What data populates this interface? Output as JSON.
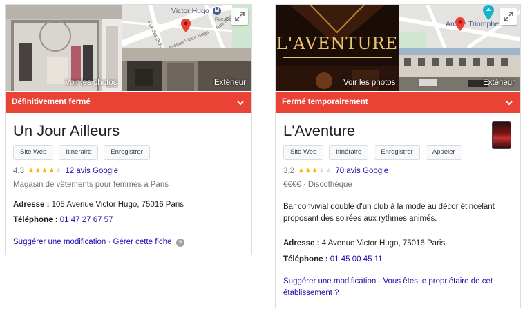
{
  "left": {
    "photo_label": "Voir les photos",
    "street_label": "Extérieur",
    "map_label_top": "Victor Hugo",
    "map_street_1": "Rue des Belles Feuilles",
    "map_street_2": "Avenue Victor Hugo",
    "map_street_3": "Rue Mesnil",
    "map_street_4": "Rue Co",
    "status": "Définitivement fermé",
    "title": "Un Jour Ailleurs",
    "actions": [
      "Site Web",
      "Itinéraire",
      "Enregistrer"
    ],
    "rating": "4,3",
    "stars": 4.3,
    "reviews": "12 avis Google",
    "category": "Magasin de vêtements pour femmes à Paris",
    "address_label": "Adresse :",
    "address_value": "105 Avenue Victor Hugo, 75016 Paris",
    "phone_label": "Téléphone :",
    "phone_value": "01 47 27 67 57",
    "suggest": "Suggérer une modification",
    "separator": "·",
    "manage": "Gérer cette fiche",
    "help": "?"
  },
  "right": {
    "photo_label": "Voir les photos",
    "street_label": "Extérieur",
    "logo_text": "L'AVENTURE",
    "map_label": "Arc de Triomphe",
    "status": "Fermé temporairement",
    "title": "L'Aventure",
    "actions": [
      "Site Web",
      "Itinéraire",
      "Enregistrer",
      "Appeler"
    ],
    "rating": "3,2",
    "stars": 3.2,
    "reviews": "70 avis Google",
    "price": "€€€€",
    "dot": "·",
    "category": "Discothèque",
    "description": "Bar convivial doublé d'un club à la mode au décor étincelant proposant des soirées aux rythmes animés.",
    "address_label": "Adresse :",
    "address_value": "4 Avenue Victor Hugo, 75016 Paris",
    "phone_label": "Téléphone :",
    "phone_value": "01 45 00 45 11",
    "suggest": "Suggérer une modification",
    "separator": "·",
    "owner_question": "Vous êtes le propriétaire de cet établissement ?"
  },
  "colors": {
    "status_red": "#ea4335",
    "link_blue": "#1a0dab",
    "star_gold": "#f4b400",
    "map_pin": "#ea4335"
  }
}
